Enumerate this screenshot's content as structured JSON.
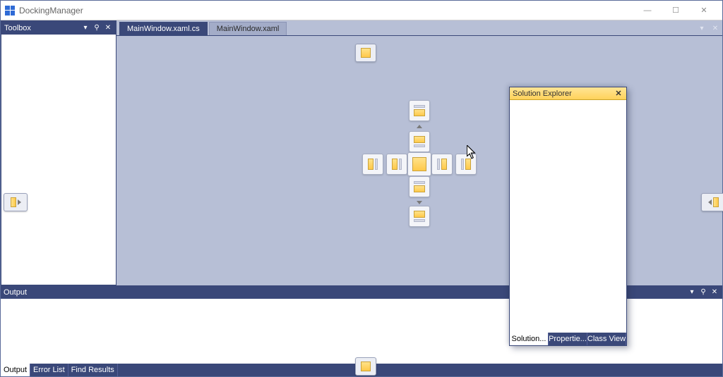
{
  "window": {
    "title": "DockingManager"
  },
  "toolbox": {
    "title": "Toolbox"
  },
  "doc": {
    "tabs": [
      {
        "label": "MainWindow.xaml.cs",
        "active": true
      },
      {
        "label": "MainWindow.xaml",
        "active": false
      }
    ]
  },
  "output": {
    "title": "Output",
    "tabs": [
      {
        "label": "Output",
        "active": true
      },
      {
        "label": "Error List",
        "active": false
      },
      {
        "label": "Find Results",
        "active": false
      }
    ]
  },
  "solution": {
    "title": "Solution Explorer",
    "tabs": [
      {
        "label": "Solution...",
        "active": true
      },
      {
        "label": "Propertie...",
        "active": false
      },
      {
        "label": "Class View",
        "active": false
      }
    ]
  },
  "icons": {
    "dropdown": "▾",
    "pin": "⚲",
    "close": "✕",
    "minimize": "—",
    "maximize": "☐"
  }
}
